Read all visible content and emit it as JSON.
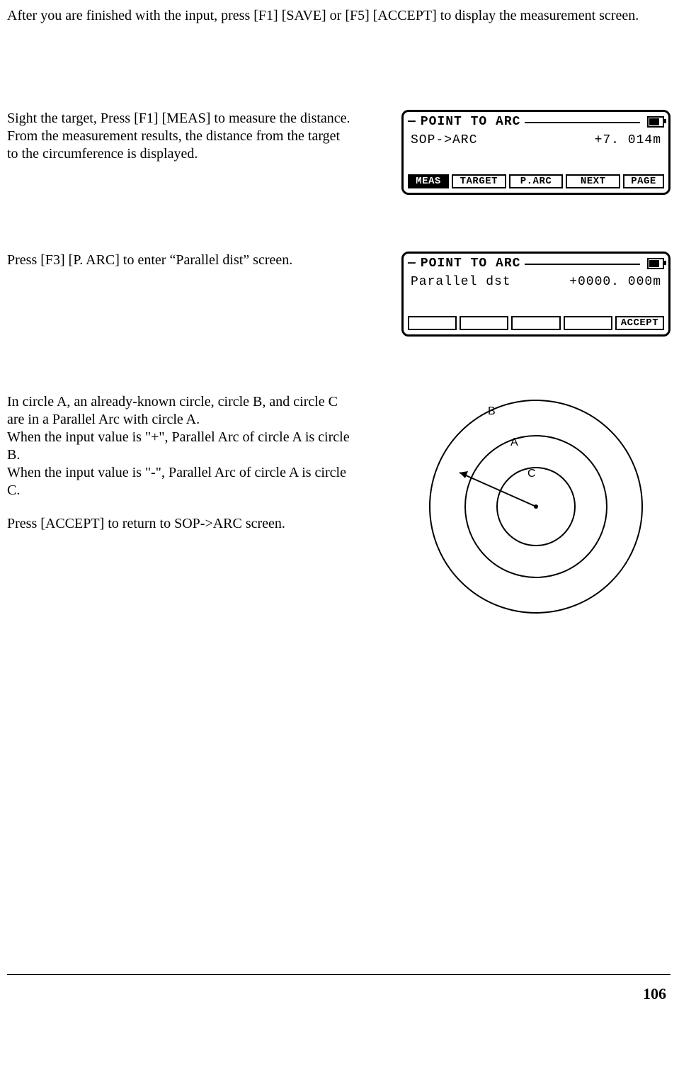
{
  "intro": "After you are finished with the input, press [F1] [SAVE] or [F5] [ACCEPT] to display the measurement screen.",
  "step1_text": "Sight the target, Press [F1] [MEAS] to measure the distance. From the measurement results, the distance from the target to the circumference is displayed.",
  "step2_text": "Press [F3] [P. ARC] to enter “Parallel dist” screen.",
  "step3_text_a": "In circle A, an already-known circle, circle B, and circle C are in a Parallel Arc with circle A.",
  "step3_text_b": "When the input value is \"+\", Parallel Arc of circle A is circle B.",
  "step3_text_c": "When the input value is \"-\", Parallel Arc of circle A is circle C.",
  "step3_text_d": "Press [ACCEPT] to return to SOP->ARC screen.",
  "lcd1": {
    "title": "POINT TO ARC",
    "left": "SOP->ARC",
    "right": "+7. 014m",
    "keys": [
      "MEAS",
      "TARGET",
      "P.ARC",
      "NEXT",
      "PAGE"
    ]
  },
  "lcd2": {
    "title": "POINT TO ARC",
    "left": "Parallel dst",
    "right": "+0000. 000m",
    "keys": [
      "",
      "",
      "",
      "",
      "ACCEPT"
    ]
  },
  "diagram_labels": {
    "a": "A",
    "b": "B",
    "c": "C"
  },
  "page_number": "106"
}
